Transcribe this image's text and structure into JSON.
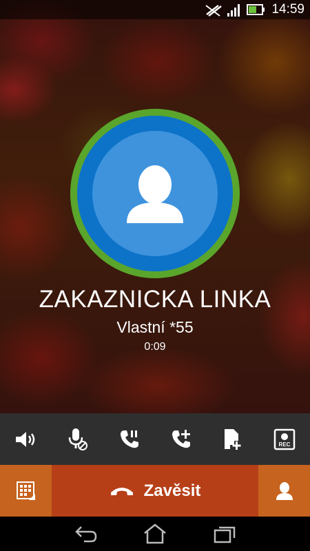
{
  "status_bar": {
    "time": "14:59",
    "icons": [
      "signal-muted-icon",
      "signal-strength-icon",
      "battery-charging-icon"
    ]
  },
  "call": {
    "contact_name": "ZAKAZNICKA LINKA",
    "number_label": "Vlastní *55",
    "duration": "0:09",
    "avatar_icon": "contact-placeholder-icon"
  },
  "toolbar": {
    "buttons": [
      "speaker-icon",
      "mute-mic-icon",
      "hold-call-icon",
      "add-call-icon",
      "add-note-icon",
      "record-icon"
    ],
    "record_label": "REC"
  },
  "actions": {
    "hangup_label": "Zavěsit",
    "dialpad_icon": "dialpad-icon",
    "contact_icon": "contact-icon"
  },
  "colors": {
    "avatar_ring": "#5aa52c",
    "avatar_blue": "#0d73c8",
    "hangup": "#b63f18",
    "side_buttons": "#c6631f"
  },
  "nav_bar": [
    "back-icon",
    "home-icon",
    "recent-apps-icon"
  ]
}
